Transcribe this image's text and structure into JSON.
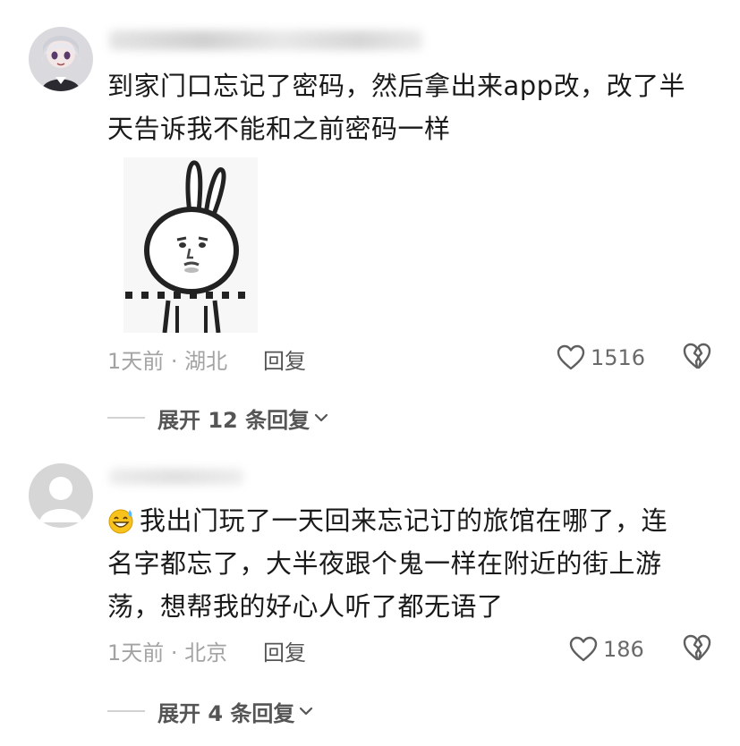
{
  "comments": [
    {
      "text_line1": "到家门口忘记了密码，然后拿出来app改，改了半",
      "text_line2": "天告诉我不能和之前密码一样",
      "time_location": "1天前 · 湖北",
      "reply_label": "回复",
      "likes": "1516",
      "expand_label": "展开 12 条回复"
    },
    {
      "emoji": "sweat-smile-emoji",
      "text_line1": "我出门玩了一天回来忘记订的旅馆在哪了，连",
      "text_line2": "名字都忘了，大半夜跟个鬼一样在附近的街上游",
      "text_line3": "荡，想帮我的好心人听了都无语了",
      "time_location": "1天前 · 北京",
      "reply_label": "回复",
      "likes": "186",
      "expand_label": "展开 4 条回复"
    }
  ],
  "icons": {
    "like": "heart-outline-icon",
    "dislike": "broken-heart-icon",
    "expand": "chevron-down-icon"
  },
  "colors": {
    "meta": "#a3a3a3",
    "text": "#1a1a1a",
    "secondary": "#555555"
  }
}
